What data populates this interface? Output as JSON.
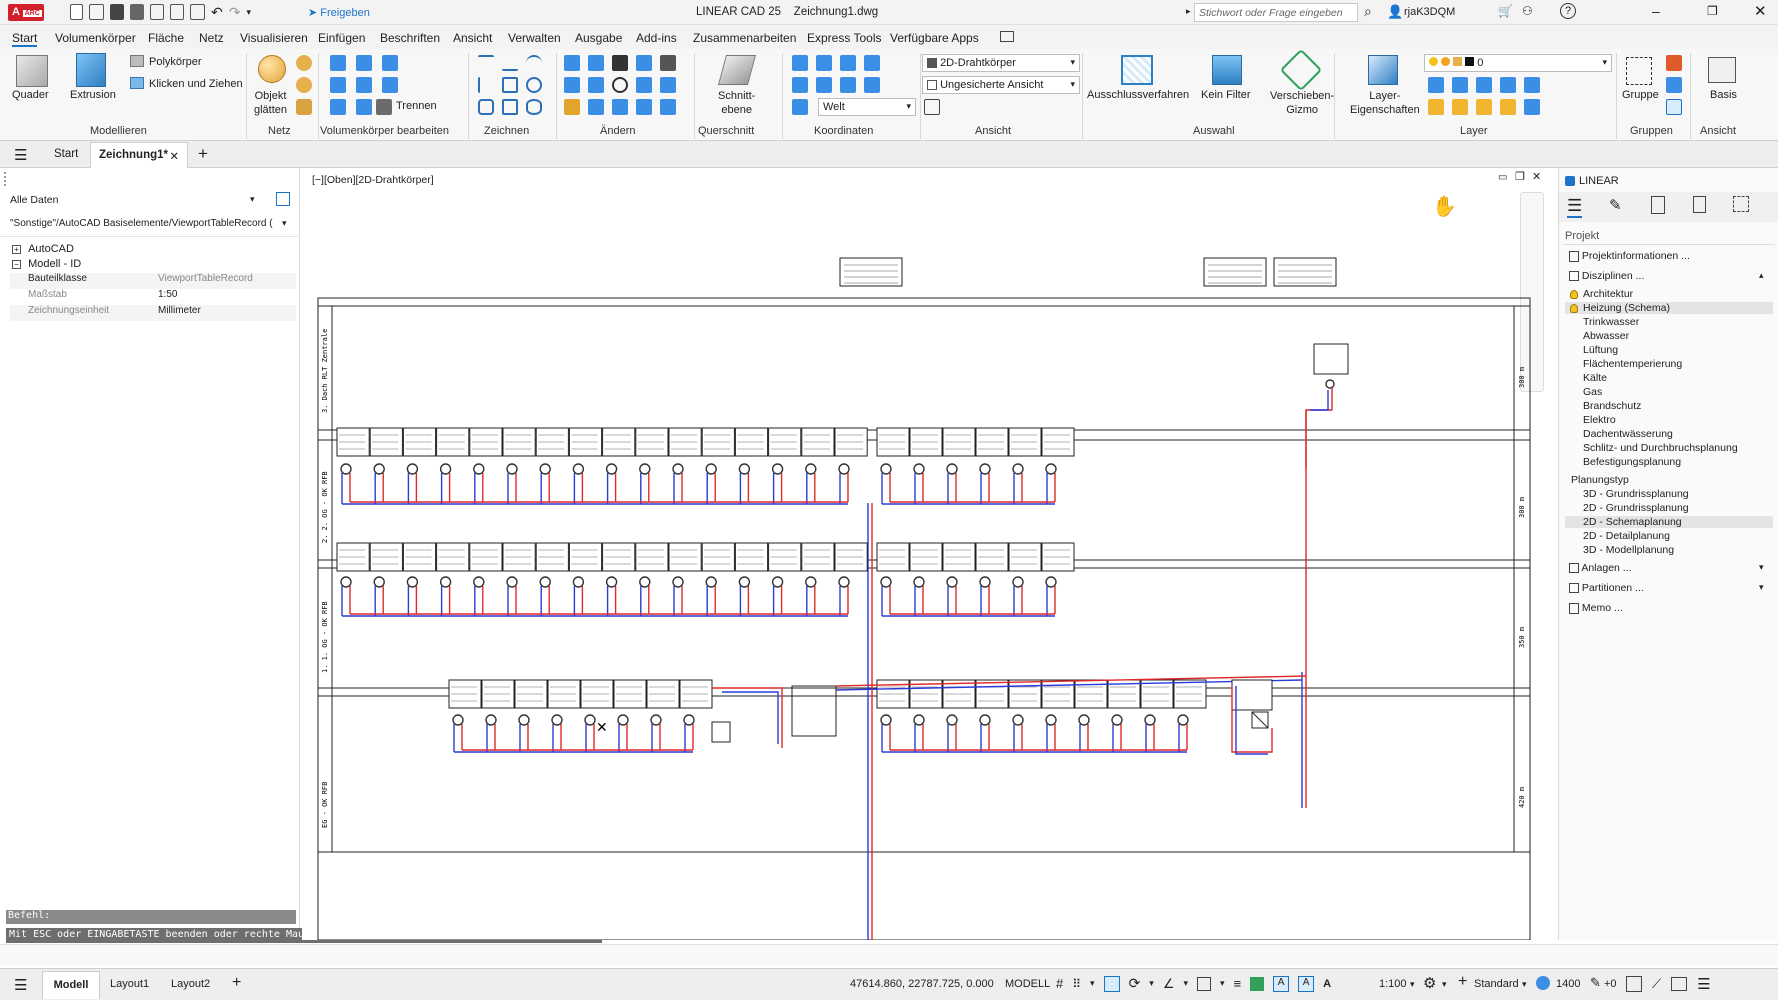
{
  "titlebar": {
    "app_badge": "A",
    "app_sub": "ARC",
    "share_label": "Freigeben",
    "app_title": "LINEAR CAD 25",
    "doc_title": "Zeichnung1.dwg",
    "search_placeholder": "Stichwort oder Frage eingeben",
    "user": "rjaK3DQM"
  },
  "menu_tabs": [
    "Start",
    "Volumenkörper",
    "Fläche",
    "Netz",
    "Visualisieren",
    "Einfügen",
    "Beschriften",
    "Ansicht",
    "Verwalten",
    "Ausgabe",
    "Add-ins",
    "Zusammenarbeiten",
    "Express Tools",
    "Verfügbare Apps"
  ],
  "ribbon": {
    "buttons": {
      "quader": "Quader",
      "extrusion": "Extrusion",
      "polykoerper": "Polykörper",
      "klicken": "Klicken und Ziehen",
      "objekt": "Objekt",
      "glaetten": "glätten",
      "trennen": "Trennen",
      "schnitt1": "Schnitt-",
      "schnitt2": "ebene",
      "welt": "Welt",
      "view_style": "2D-Drahtkörper",
      "view_saved": "Ungesicherte Ansicht",
      "ausschluss": "Ausschlussverfahren",
      "keinfilter": "Kein Filter",
      "gizmo1": "Verschieben-",
      "gizmo2": "Gizmo",
      "layer1": "Layer-",
      "layer2": "Eigenschaften",
      "layer_value": "0",
      "gruppe": "Gruppe",
      "basis": "Basis"
    },
    "groups": [
      "Modellieren",
      "Netz",
      "Volumenkörper bearbeiten",
      "Zeichnen",
      "Ändern",
      "Querschnitt",
      "Koordinaten",
      "Ansicht",
      "Auswahl",
      "Layer",
      "Gruppen",
      "Ansicht"
    ]
  },
  "doc_tabs": {
    "start": "Start",
    "active": "Zeichnung1*"
  },
  "left_panel": {
    "filter": "Alle Daten",
    "path": "\"Sonstige\"/AutoCAD Basiselemente/ViewportTableRecord (",
    "tree_autocad": "AutoCAD",
    "tree_modell": "Modell - ID",
    "props": [
      {
        "key": "Bauteilklasse",
        "value": "ViewportTableRecord"
      },
      {
        "key": "Maßstab",
        "value": "1:50"
      },
      {
        "key": "Zeichnungseinheit",
        "value": "Millimeter"
      }
    ]
  },
  "viewport": {
    "label": "[−][Oben][2D-Drahtkörper]",
    "floor_labels": [
      "3. Dach RLT Zentrale",
      "2. 2. OG - OK RFB",
      "1. 1. OG - OK RFB",
      "EG - OK RFB"
    ],
    "floor_heights": [
      "300 m",
      "300 m",
      "350 m",
      "420 m"
    ]
  },
  "command": {
    "label": "Befehl:",
    "message": "Mit ESC oder EINGABETASTE beenden oder rechte Maustaste klicken, um das Kontextmenü zu aktivieren."
  },
  "right_panel": {
    "title": "LINEAR",
    "section": "Projekt",
    "projektinfo": "Projektinformationen ...",
    "disziplinen": "Disziplinen ...",
    "disciplines": [
      "Architektur",
      "Heizung (Schema)",
      "Trinkwasser",
      "Abwasser",
      "Lüftung",
      "Flächentemperierung",
      "Kälte",
      "Gas",
      "Brandschutz",
      "Elektro",
      "Dachentwässerung",
      "Schlitz- und Durchbruchsplanung",
      "Befestigungsplanung"
    ],
    "planungstyp": "Planungstyp",
    "planning_types": [
      "3D - Grundrissplanung",
      "2D - Grundrissplanung",
      "2D - Schemaplanung",
      "2D - Detailplanung",
      "3D - Modellplanung"
    ],
    "anlagen": "Anlagen ...",
    "partitionen": "Partitionen ...",
    "memo": "Memo ..."
  },
  "statusbar": {
    "tabs": [
      "Modell",
      "Layout1",
      "Layout2"
    ],
    "coords": "47614.860, 22787.725, 0.000",
    "space": "MODELL",
    "scale": "1:100",
    "standard": "Standard",
    "lineweight": "1400",
    "plus_zero": "+0"
  }
}
